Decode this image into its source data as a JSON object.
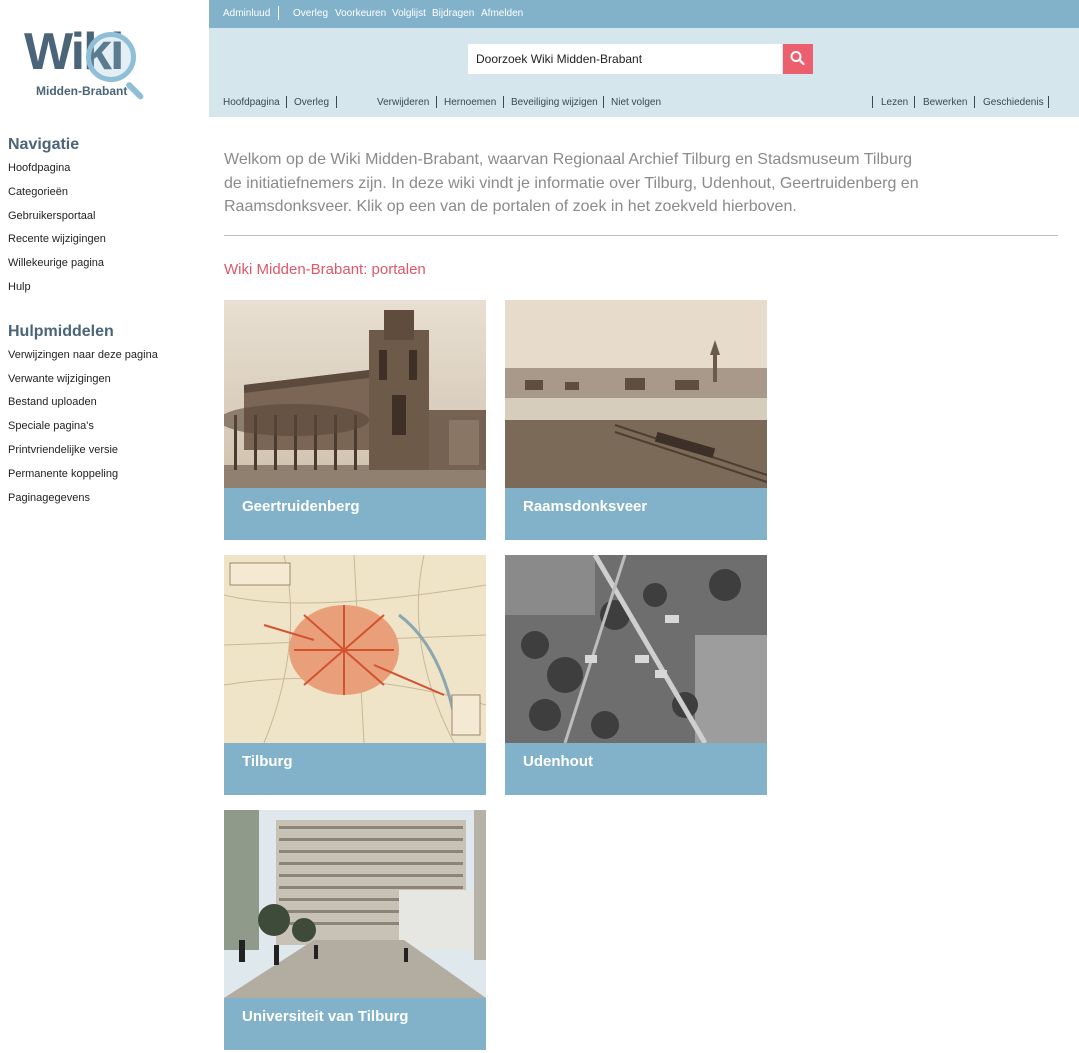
{
  "logo": {
    "wordmark": "Wiki",
    "subtitle": "Midden-Brabant"
  },
  "top_nav": {
    "user": "Adminluud",
    "items": [
      "Overleg",
      "Voorkeuren",
      "Volglijst",
      "Bijdragen",
      "Afmelden"
    ]
  },
  "search": {
    "value": "Doorzoek Wiki Midden-Brabant",
    "button_icon": "search-icon"
  },
  "page_tabs": {
    "left": [
      "Hoofdpagina",
      "Overleg"
    ],
    "actions": [
      "Verwijderen",
      "Hernoemen",
      "Beveiliging wijzigen",
      "Niet volgen"
    ],
    "views": [
      "Lezen",
      "Bewerken",
      "Geschiedenis"
    ]
  },
  "sidebar": {
    "navigatie": {
      "title": "Navigatie",
      "items": [
        "Hoofdpagina",
        "Categorieën",
        "Gebruikersportaal",
        "Recente wijzigingen",
        "Willekeurige pagina",
        "Hulp"
      ]
    },
    "hulpmiddelen": {
      "title": "Hulpmiddelen",
      "items": [
        "Verwijzingen naar deze pagina",
        "Verwante wijzigingen",
        "Bestand uploaden",
        "Speciale pagina's",
        "Printvriendelijke versie",
        "Permanente koppeling",
        "Paginagegevens"
      ]
    }
  },
  "main": {
    "intro": "Welkom op de Wiki Midden-Brabant, waarvan Regionaal Archief Tilburg en Stadsmuseum Tilburg de initiatiefnemers zijn. In deze wiki vindt je informatie over Tilburg, Udenhout, Geertruidenberg en Raamsdonksveer. Klik op een van de portalen of zoek in het zoekveld hierboven.",
    "portals_heading": "Wiki Midden-Brabant: portalen",
    "portals": [
      {
        "label": "Geertruidenberg"
      },
      {
        "label": "Raamsdonksveer"
      },
      {
        "label": "Tilburg"
      },
      {
        "label": "Udenhout"
      },
      {
        "label": "Universiteit van Tilburg"
      }
    ]
  },
  "colors": {
    "topbar": "#82b2c9",
    "searchbar": "#d6e6ed",
    "search_button": "#ec5f6f",
    "portal_band": "#82b2c9",
    "heading_accent": "#e05767",
    "sidebar_heading": "#4a6478"
  }
}
